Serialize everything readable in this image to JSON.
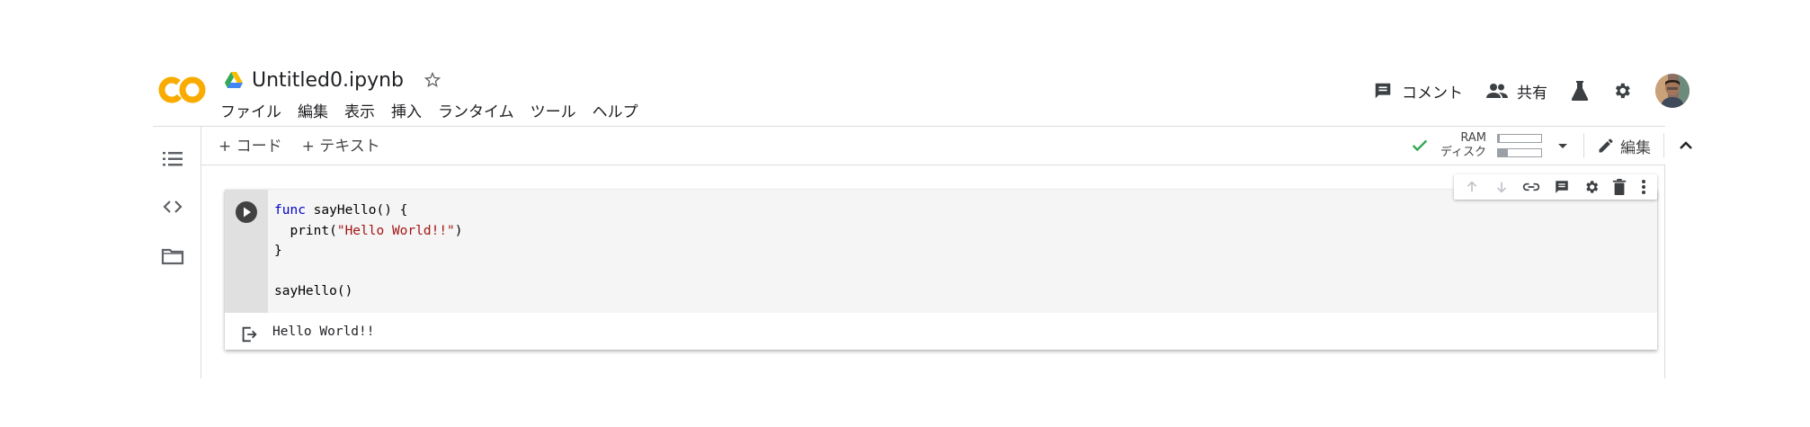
{
  "header": {
    "logo_text": "CO",
    "title": "Untitled0.ipynb",
    "menu": [
      "ファイル",
      "編集",
      "表示",
      "挿入",
      "ランタイム",
      "ツール",
      "ヘルプ"
    ],
    "comment_label": "コメント",
    "share_label": "共有"
  },
  "toolbar": {
    "add_code_label": "+ コード",
    "add_text_label": "+ テキスト",
    "ram_label": "RAM",
    "disk_label": "ディスク",
    "ram_usage": 0.04,
    "disk_usage": 0.22,
    "edit_label": "編集"
  },
  "cell": {
    "code_lines": [
      {
        "kw": "func",
        "rest": " sayHello() {"
      },
      {
        "pre": "  print(",
        "str": "\"Hello World!!\"",
        "post": ")"
      },
      {
        "text": "}"
      },
      {
        "text": ""
      },
      {
        "text": "sayHello()"
      }
    ],
    "output": "Hello World!!"
  },
  "colors": {
    "logo_orange": "#f9ab00",
    "logo_yellow": "#e37400",
    "keyword": "#0000cc",
    "string": "#a31515",
    "check": "#34a853"
  }
}
